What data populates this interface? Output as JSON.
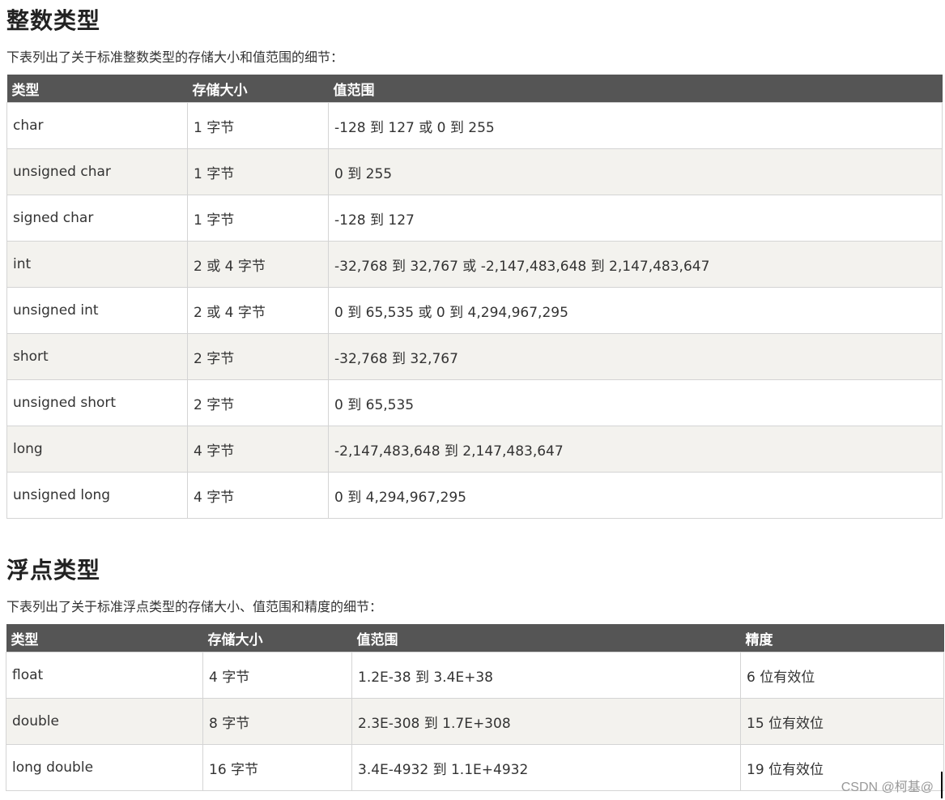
{
  "int_section": {
    "title": "整数类型",
    "description": "下表列出了关于标准整数类型的存储大小和值范围的细节：",
    "headers": [
      "类型",
      "存储大小",
      "值范围"
    ],
    "rows": [
      [
        "char",
        "1 字节",
        "-128 到 127 或 0 到 255"
      ],
      [
        "unsigned char",
        "1 字节",
        "0 到 255"
      ],
      [
        "signed char",
        "1 字节",
        "-128 到 127"
      ],
      [
        "int",
        "2 或 4 字节",
        "-32,768 到 32,767 或 -2,147,483,648 到 2,147,483,647"
      ],
      [
        "unsigned int",
        "2 或 4 字节",
        "0 到 65,535 或 0 到 4,294,967,295"
      ],
      [
        "short",
        "2 字节",
        "-32,768 到 32,767"
      ],
      [
        "unsigned short",
        "2 字节",
        "0 到 65,535"
      ],
      [
        "long",
        "4 字节",
        "-2,147,483,648 到 2,147,483,647"
      ],
      [
        "unsigned long",
        "4 字节",
        "0 到 4,294,967,295"
      ]
    ]
  },
  "float_section": {
    "title": "浮点类型",
    "description": "下表列出了关于标准浮点类型的存储大小、值范围和精度的细节：",
    "headers": [
      "类型",
      "存储大小",
      "值范围",
      "精度"
    ],
    "rows": [
      [
        "float",
        "4 字节",
        "1.2E-38 到 3.4E+38",
        "6 位有效位"
      ],
      [
        "double",
        "8 字节",
        "2.3E-308 到 1.7E+308",
        "15 位有效位"
      ],
      [
        "long double",
        "16 字节",
        "3.4E-4932 到 1.1E+4932",
        "19 位有效位"
      ]
    ]
  },
  "watermark": "CSDN @柯基@",
  "colors": {
    "header_bg": "#555555",
    "header_text": "#ffffff",
    "stripe_bg": "#f3f2ee",
    "border": "#d4d4d4"
  }
}
